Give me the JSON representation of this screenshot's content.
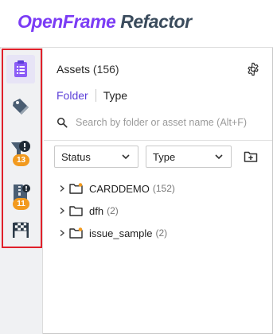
{
  "header": {
    "brand_part1": "OpenFrame",
    "brand_part2": "Refactor"
  },
  "rail": {
    "items": [
      {
        "icon": "clipboard-list-icon",
        "active": true
      },
      {
        "icon": "tag-icon"
      },
      {
        "icon": "alert-funnel-icon",
        "badge": "13"
      },
      {
        "icon": "zip-file-alert-icon",
        "badge": "11"
      },
      {
        "icon": "checkered-flag-icon"
      }
    ]
  },
  "panel": {
    "title": "Assets",
    "count": "(156)",
    "tabs": {
      "folder": "Folder",
      "type": "Type"
    },
    "search": {
      "placeholder": "Search by folder or asset name (Alt+F)"
    },
    "filters": {
      "status": "Status",
      "type": "Type"
    },
    "tree": [
      {
        "name": "CARDDEMO",
        "count": "(152)"
      },
      {
        "name": "dfh",
        "count": "(2)"
      },
      {
        "name": "issue_sample",
        "count": "(2)"
      }
    ]
  },
  "colors": {
    "accent": "#5b3fd8",
    "brand_purple": "#7b3cf5",
    "badge_orange": "#f29a1f",
    "highlight_red": "#e0202a"
  }
}
